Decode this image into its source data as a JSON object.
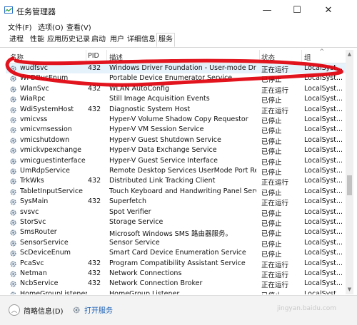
{
  "window": {
    "title": "任务管理器",
    "min_label": "—",
    "max_label": "☐",
    "close_label": "✕"
  },
  "menu": [
    "文件(F)",
    "选项(O)",
    "查看(V)"
  ],
  "tabs": [
    "进程",
    "性能",
    "应用历史记录",
    "启动",
    "用户",
    "详细信息",
    "服务"
  ],
  "active_tab": "服务",
  "columns": {
    "name": "名称",
    "pid": "PID",
    "desc": "描述",
    "status": "状态",
    "group": "组"
  },
  "rows": [
    {
      "name": "wudfsvc",
      "pid": "432",
      "desc": "Windows Driver Foundation - User-mode Dri...",
      "status": "正在运行",
      "group": "LocalSyst...",
      "selected": true
    },
    {
      "name": "WPDBusEnum",
      "pid": "",
      "desc": "Portable Device Enumerator Service",
      "status": "已停止",
      "group": "LocalSyst...",
      "selected": false
    },
    {
      "name": "WlanSvc",
      "pid": "432",
      "desc": "WLAN AutoConfig",
      "status": "正在运行",
      "group": "LocalSyst...",
      "selected": false
    },
    {
      "name": "WiaRpc",
      "pid": "",
      "desc": "Still Image Acquisition Events",
      "status": "已停止",
      "group": "LocalSyst...",
      "selected": false
    },
    {
      "name": "WdiSystemHost",
      "pid": "432",
      "desc": "Diagnostic System Host",
      "status": "正在运行",
      "group": "LocalSyst...",
      "selected": false
    },
    {
      "name": "vmicvss",
      "pid": "",
      "desc": "Hyper-V Volume Shadow Copy Requestor",
      "status": "已停止",
      "group": "LocalSyst...",
      "selected": false
    },
    {
      "name": "vmicvmsession",
      "pid": "",
      "desc": "Hyper-V VM Session Service",
      "status": "已停止",
      "group": "LocalSyst...",
      "selected": false
    },
    {
      "name": "vmicshutdown",
      "pid": "",
      "desc": "Hyper-V Guest Shutdown Service",
      "status": "已停止",
      "group": "LocalSyst...",
      "selected": false
    },
    {
      "name": "vmickvpexchange",
      "pid": "",
      "desc": "Hyper-V Data Exchange Service",
      "status": "已停止",
      "group": "LocalSyst...",
      "selected": false
    },
    {
      "name": "vmicguestinterface",
      "pid": "",
      "desc": "Hyper-V Guest Service Interface",
      "status": "已停止",
      "group": "LocalSyst...",
      "selected": false
    },
    {
      "name": "UmRdpService",
      "pid": "",
      "desc": "Remote Desktop Services UserMode Port Re...",
      "status": "已停止",
      "group": "LocalSyst...",
      "selected": false
    },
    {
      "name": "TrkWks",
      "pid": "432",
      "desc": "Distributed Link Tracking Client",
      "status": "正在运行",
      "group": "LocalSyst...",
      "selected": false
    },
    {
      "name": "TabletInputService",
      "pid": "",
      "desc": "Touch Keyboard and Handwriting Panel Servi...",
      "status": "已停止",
      "group": "LocalSyst...",
      "selected": false
    },
    {
      "name": "SysMain",
      "pid": "432",
      "desc": "Superfetch",
      "status": "正在运行",
      "group": "LocalSyst...",
      "selected": false
    },
    {
      "name": "svsvc",
      "pid": "",
      "desc": "Spot Verifier",
      "status": "已停止",
      "group": "LocalSyst...",
      "selected": false
    },
    {
      "name": "StorSvc",
      "pid": "",
      "desc": "Storage Service",
      "status": "已停止",
      "group": "LocalSyst...",
      "selected": false
    },
    {
      "name": "SmsRouter",
      "pid": "",
      "desc": "Microsoft Windows SMS 路由器服务。",
      "status": "已停止",
      "group": "LocalSyst...",
      "selected": false
    },
    {
      "name": "SensorService",
      "pid": "",
      "desc": "Sensor Service",
      "status": "已停止",
      "group": "LocalSyst...",
      "selected": false
    },
    {
      "name": "ScDeviceEnum",
      "pid": "",
      "desc": "Smart Card Device Enumeration Service",
      "status": "已停止",
      "group": "LocalSyst...",
      "selected": false
    },
    {
      "name": "PcaSvc",
      "pid": "432",
      "desc": "Program Compatibility Assistant Service",
      "status": "正在运行",
      "group": "LocalSyst...",
      "selected": false
    },
    {
      "name": "Netman",
      "pid": "432",
      "desc": "Network Connections",
      "status": "正在运行",
      "group": "LocalSyst...",
      "selected": false
    },
    {
      "name": "NcbService",
      "pid": "432",
      "desc": "Network Connection Broker",
      "status": "正在运行",
      "group": "LocalSyst...",
      "selected": false
    },
    {
      "name": "HomeGroupListener",
      "pid": "",
      "desc": "HomeGroup Listener",
      "status": "已停止",
      "group": "LocalSyst...",
      "selected": false
    }
  ],
  "footer": {
    "brief_label": "简略信息(D)",
    "open_services_label": "打开服务"
  },
  "watermark": "jingyan.baidu.com",
  "colors": {
    "accent": "#1a5fb4",
    "selection": "#e6f2fb",
    "annotation": "#e0000b"
  }
}
